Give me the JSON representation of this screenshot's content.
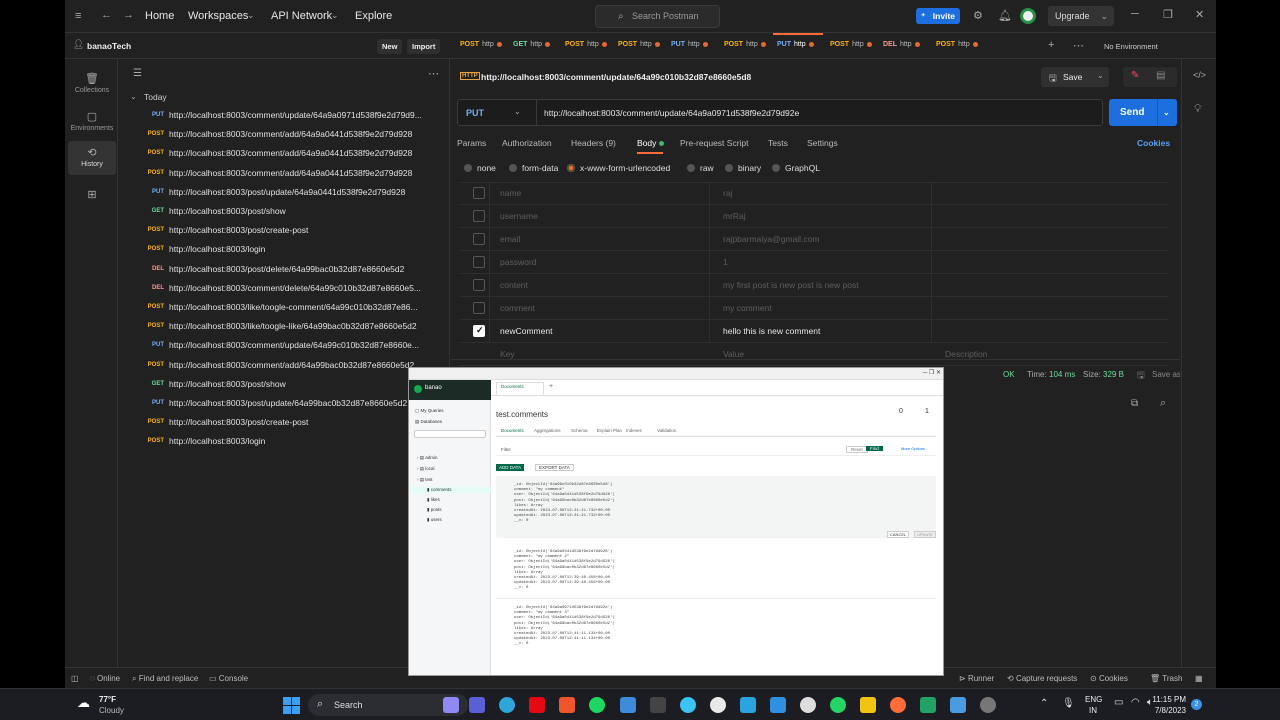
{
  "topbar": {
    "home": "Home",
    "workspaces": "Workspaces",
    "api_network": "API Network",
    "explore": "Explore",
    "search_placeholder": "Search Postman",
    "invite": "Invite",
    "upgrade": "Upgrade"
  },
  "workspace": {
    "name": "banaoTech",
    "new_label": "New",
    "import_label": "Import"
  },
  "tabs": [
    {
      "method": "POST",
      "label": "http"
    },
    {
      "method": "GET",
      "label": "http"
    },
    {
      "method": "POST",
      "label": "http"
    },
    {
      "method": "POST",
      "label": "http"
    },
    {
      "method": "PUT",
      "label": "http"
    },
    {
      "method": "POST",
      "label": "http"
    },
    {
      "method": "PUT",
      "label": "http"
    },
    {
      "method": "POST",
      "label": "http"
    },
    {
      "method": "DEL",
      "label": "http"
    },
    {
      "method": "POST",
      "label": "http"
    }
  ],
  "environment": "No Environment",
  "nav": {
    "collections": "Collections",
    "environments": "Environments",
    "history": "History"
  },
  "history": {
    "group": "Today",
    "items": [
      {
        "method": "PUT",
        "url": "http://localhost:8003/comment/update/64a9a0971d538f9e2d79d9..."
      },
      {
        "method": "POST",
        "url": "http://localhost:8003/comment/add/64a9a0441d538f9e2d79d928"
      },
      {
        "method": "POST",
        "url": "http://localhost:8003/comment/add/64a9a0441d538f9e2d79d928"
      },
      {
        "method": "POST",
        "url": "http://localhost:8003/comment/add/64a9a0441d538f9e2d79d928"
      },
      {
        "method": "PUT",
        "url": "http://localhost:8003/post/update/64a9a0441d538f9e2d79d928"
      },
      {
        "method": "GET",
        "url": "http://localhost:8003/post/show"
      },
      {
        "method": "POST",
        "url": "http://localhost:8003/post/create-post"
      },
      {
        "method": "POST",
        "url": "http://localhost:8003/login"
      },
      {
        "method": "DEL",
        "url": "http://localhost:8003/post/delete/64a99bac0b32d87e8660e5d2"
      },
      {
        "method": "DEL",
        "url": "http://localhost:8003/comment/delete/64a99c010b32d87e8660e5..."
      },
      {
        "method": "POST",
        "url": "http://localhost:8003/like/toogle-comment/64a99c010b32d87e86..."
      },
      {
        "method": "POST",
        "url": "http://localhost:8003/like/toogle-like/64a99bac0b32d87e8660e5d2"
      },
      {
        "method": "PUT",
        "url": "http://localhost:8003/comment/update/64a99c010b32d87e8660e..."
      },
      {
        "method": "POST",
        "url": "http://localhost:8003/comment/add/64a99bac0b32d87e8660e5d2"
      },
      {
        "method": "GET",
        "url": "http://localhost:8003/post/show"
      },
      {
        "method": "PUT",
        "url": "http://localhost:8003/post/update/64a99bac0b32d87e8660e5d2"
      },
      {
        "method": "POST",
        "url": "http://localhost:8003/post/create-post"
      },
      {
        "method": "POST",
        "url": "http://localhost:8003/login"
      }
    ]
  },
  "request": {
    "title": "http://localhost:8003/comment/update/64a99c010b32d87e8660e5d8",
    "save": "Save",
    "method": "PUT",
    "url": "http://localhost:8003/comment/update/64a9a0971d538f9e2d79d92e",
    "send": "Send",
    "tabs": [
      "Params",
      "Authorization",
      "Headers (9)",
      "Body",
      "Pre-request Script",
      "Tests",
      "Settings"
    ],
    "cookies": "Cookies",
    "body_types": [
      "none",
      "form-data",
      "x-www-form-urlencoded",
      "raw",
      "binary",
      "GraphQL"
    ],
    "rows": [
      {
        "key": "name",
        "value": "raj",
        "checked": false
      },
      {
        "key": "username",
        "value": "mrRaj",
        "checked": false
      },
      {
        "key": "email",
        "value": "rajpbarmaiya@gmail.com",
        "checked": false
      },
      {
        "key": "password",
        "value": "1",
        "checked": false
      },
      {
        "key": "content",
        "value": "my first post is new post is new post",
        "checked": false
      },
      {
        "key": "comment",
        "value": "my comment",
        "checked": false
      },
      {
        "key": "newComment",
        "value": "hello this is new comment",
        "checked": true
      }
    ],
    "placeholder_key": "Key",
    "placeholder_value": "Value",
    "placeholder_desc": "Description"
  },
  "response": {
    "status_suffix": "OK",
    "time_label": "Time:",
    "time": "104 ms",
    "size_label": "Size:",
    "size": "329 B",
    "save_example": "Save as Example"
  },
  "statusbar": {
    "online": "Online",
    "find": "Find and replace",
    "console": "Console",
    "runner": "Runner",
    "capture": "Capture requests",
    "cookies": "Cookies",
    "trash": "Trash"
  },
  "compass": {
    "app": "banao",
    "tab": "Documents",
    "collection": "test.comments",
    "docs_count": "0",
    "indexes_count": "1",
    "subtabs": [
      "Documents",
      "Aggregations",
      "Schema",
      "Explain Plan",
      "Indexes",
      "Validation"
    ],
    "add_data": "ADD DATA",
    "export": "EXPORT DATA",
    "databases": [
      "admin",
      "local",
      "test"
    ],
    "collections": [
      "comments",
      "likes",
      "posts",
      "users"
    ],
    "filter": "Filter",
    "find": "Find",
    "reset": "Reset",
    "options": "More Options",
    "cancel": "CANCEL",
    "update": "UPDATE",
    "doc1": "_id: ObjectId('64a99c010b32d87e8660e5d8')\ncomment: \"my comment\"\nuser: ObjectId('64a9a0441d538f9e2d79d928')\npost: ObjectId('64a99bac0b32d87e8660e5d2')\nlikes: Array\ncreatedAt: 2023-07-08T12:21:21.732+00:00\nupdatedAt: 2023-07-08T12:21:21.732+00:00\n__v: 0",
    "doc2": "_id: ObjectId('64a9a0441d538f9e2d79d928')\ncomment: \"my comment 2\"\nuser: ObjectId('64a9a0441d538f9e2d79d928')\npost: ObjectId('64a99bac0b32d87e8660e5d2')\nlikes: Array\ncreatedAt: 2023-07-08T12:39:40.456+00:00\nupdatedAt: 2023-07-08T12:39:40.456+00:00\n__v: 0",
    "doc3": "_id: ObjectId('64a9a0971d538f9e2d79d92e')\ncomment: \"my comment 3\"\nuser: ObjectId('64a9a0441d538f9e2d79d928')\npost: ObjectId('64a99bac0b32d87e8660e5d2')\nlikes: Array\ncreatedAt: 2023-07-08T12:41:11.134+00:00\nupdatedAt: 2023-07-08T12:41:11.134+00:00\n__v: 0"
  },
  "taskbar": {
    "temp": "77°F",
    "weather": "Cloudy",
    "search": "Search",
    "lang1": "ENG",
    "lang2": "IN",
    "time": "11:15 PM",
    "date": "7/8/2023",
    "badge": "2"
  }
}
